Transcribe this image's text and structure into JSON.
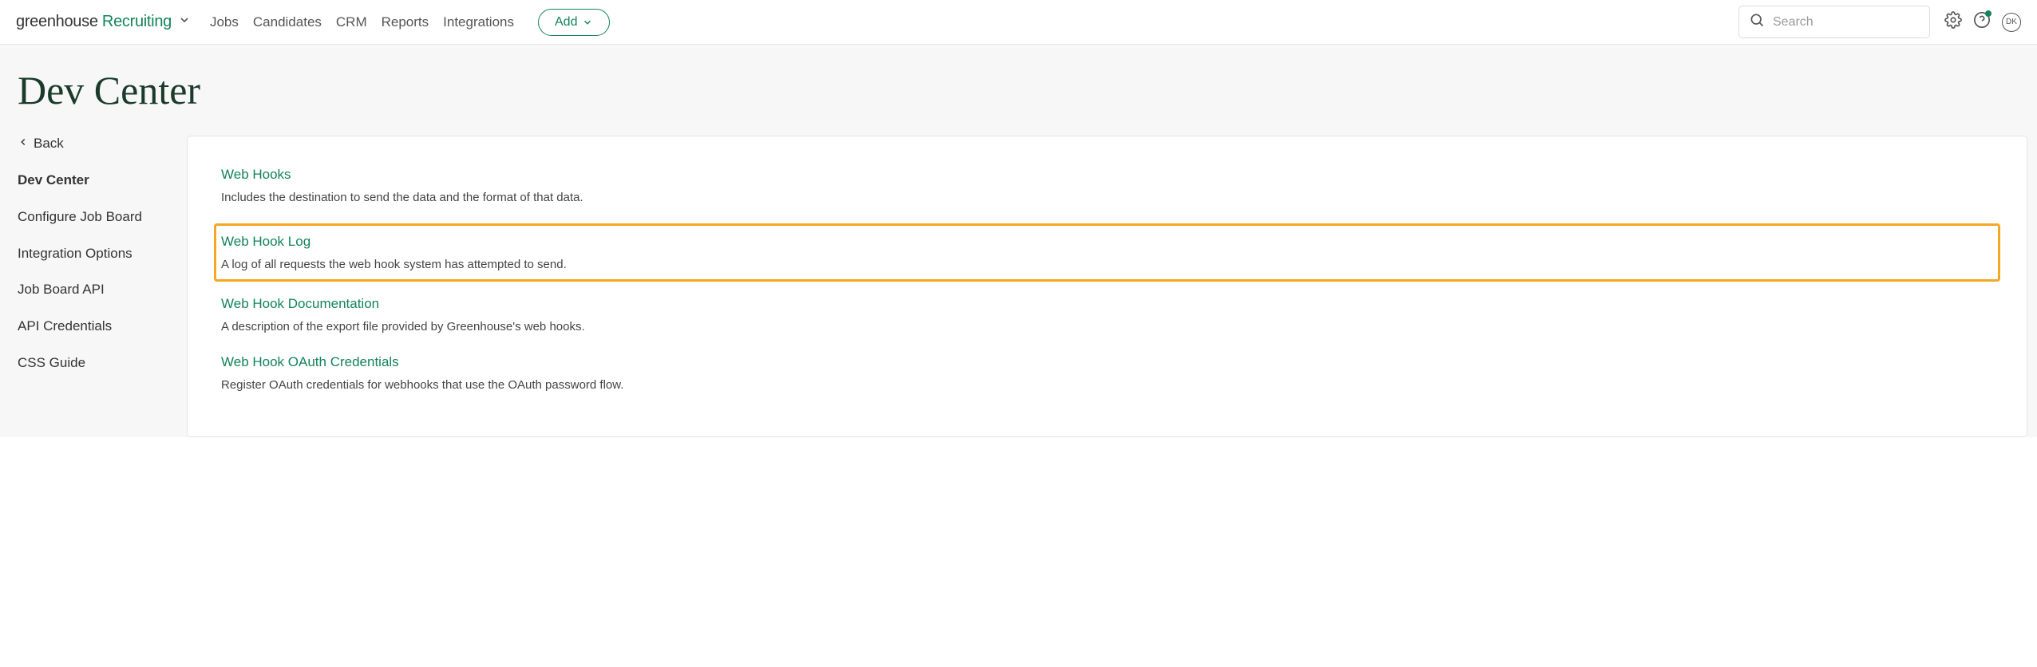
{
  "logo": {
    "gh": "greenhouse",
    "recruiting": "Recruiting"
  },
  "nav": {
    "jobs": "Jobs",
    "candidates": "Candidates",
    "crm": "CRM",
    "reports": "Reports",
    "integrations": "Integrations",
    "add": "Add"
  },
  "search": {
    "placeholder": "Search"
  },
  "avatar_initials": "DK",
  "page_title": "Dev Center",
  "sidebar": {
    "back": "Back",
    "items": [
      "Dev Center",
      "Configure Job Board",
      "Integration Options",
      "Job Board API",
      "API Credentials",
      "CSS Guide"
    ]
  },
  "sections": [
    {
      "title": "Web Hooks",
      "desc": "Includes the destination to send the data and the format of that data."
    },
    {
      "title": "Web Hook Log",
      "desc": "A log of all requests the web hook system has attempted to send."
    },
    {
      "title": "Web Hook Documentation",
      "desc": "A description of the export file provided by Greenhouse's web hooks."
    },
    {
      "title": "Web Hook OAuth Credentials",
      "desc": "Register OAuth credentials for webhooks that use the OAuth password flow."
    }
  ]
}
